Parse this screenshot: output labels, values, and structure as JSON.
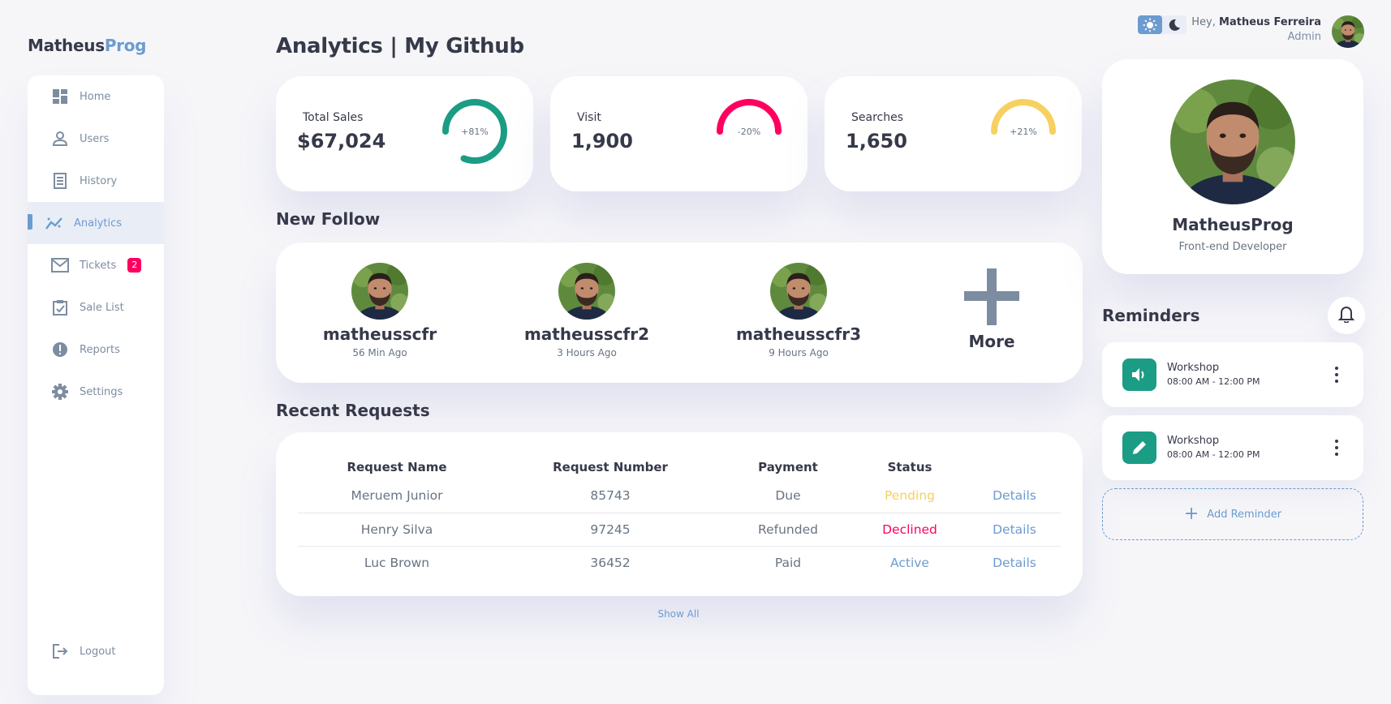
{
  "logo": {
    "part1": "Matheus",
    "part2": "Prog"
  },
  "sidebar": {
    "items": [
      {
        "label": "Home",
        "icon": "dashboard-icon"
      },
      {
        "label": "Users",
        "icon": "person-icon"
      },
      {
        "label": "History",
        "icon": "receipt-icon"
      },
      {
        "label": "Analytics",
        "icon": "insights-icon",
        "active": true
      },
      {
        "label": "Tickets",
        "icon": "mail-icon",
        "badge": "2"
      },
      {
        "label": "Sale List",
        "icon": "inventory-icon"
      },
      {
        "label": "Reports",
        "icon": "report-icon"
      },
      {
        "label": "Settings",
        "icon": "settings-icon"
      }
    ],
    "logout": "Logout"
  },
  "page_title": "Analytics | My Github",
  "stats": [
    {
      "label": "Total Sales",
      "value": "$67,024",
      "percent": "+81%",
      "fraction": 0.81,
      "color": "#1b9c85"
    },
    {
      "label": "Visit",
      "value": "1,900",
      "percent": "-20%",
      "fraction": 0.5,
      "color": "#ff0060"
    },
    {
      "label": "Searches",
      "value": "1,650",
      "percent": "+21%",
      "fraction": 0.5,
      "color": "#f7d060"
    }
  ],
  "new_follow": {
    "title": "New Follow",
    "users": [
      {
        "name": "matheusscfr",
        "time": "56 Min Ago"
      },
      {
        "name": "matheusscfr2",
        "time": "3 Hours Ago"
      },
      {
        "name": "matheusscfr3",
        "time": "9 Hours Ago"
      }
    ],
    "more": "More"
  },
  "recent_requests": {
    "title": "Recent Requests",
    "headers": [
      "Request Name",
      "Request Number",
      "Payment",
      "Status",
      ""
    ],
    "rows": [
      {
        "name": "Meruem Junior",
        "number": "85743",
        "payment": "Due",
        "status": "Pending",
        "details": "Details"
      },
      {
        "name": "Henry Silva",
        "number": "97245",
        "payment": "Refunded",
        "status": "Declined",
        "details": "Details"
      },
      {
        "name": "Luc Brown",
        "number": "36452",
        "payment": "Paid",
        "status": "Active",
        "details": "Details"
      }
    ],
    "show_all": "Show All"
  },
  "header": {
    "greeting": "Hey,",
    "user": "Matheus Ferreira",
    "role": "Admin"
  },
  "profile": {
    "name": "MatheusProg",
    "role": "Front-end Developer"
  },
  "reminders": {
    "title": "Reminders",
    "items": [
      {
        "title": "Workshop",
        "time": "08:00 AM - 12:00 PM",
        "icon": "volume-icon"
      },
      {
        "title": "Workshop",
        "time": "08:00 AM - 12:00 PM",
        "icon": "edit-icon"
      }
    ],
    "add_label": "Add Reminder"
  },
  "colors": {
    "primary": "#6c9bcf",
    "success": "#1b9c85",
    "danger": "#ff0060",
    "warning": "#f7d060"
  }
}
